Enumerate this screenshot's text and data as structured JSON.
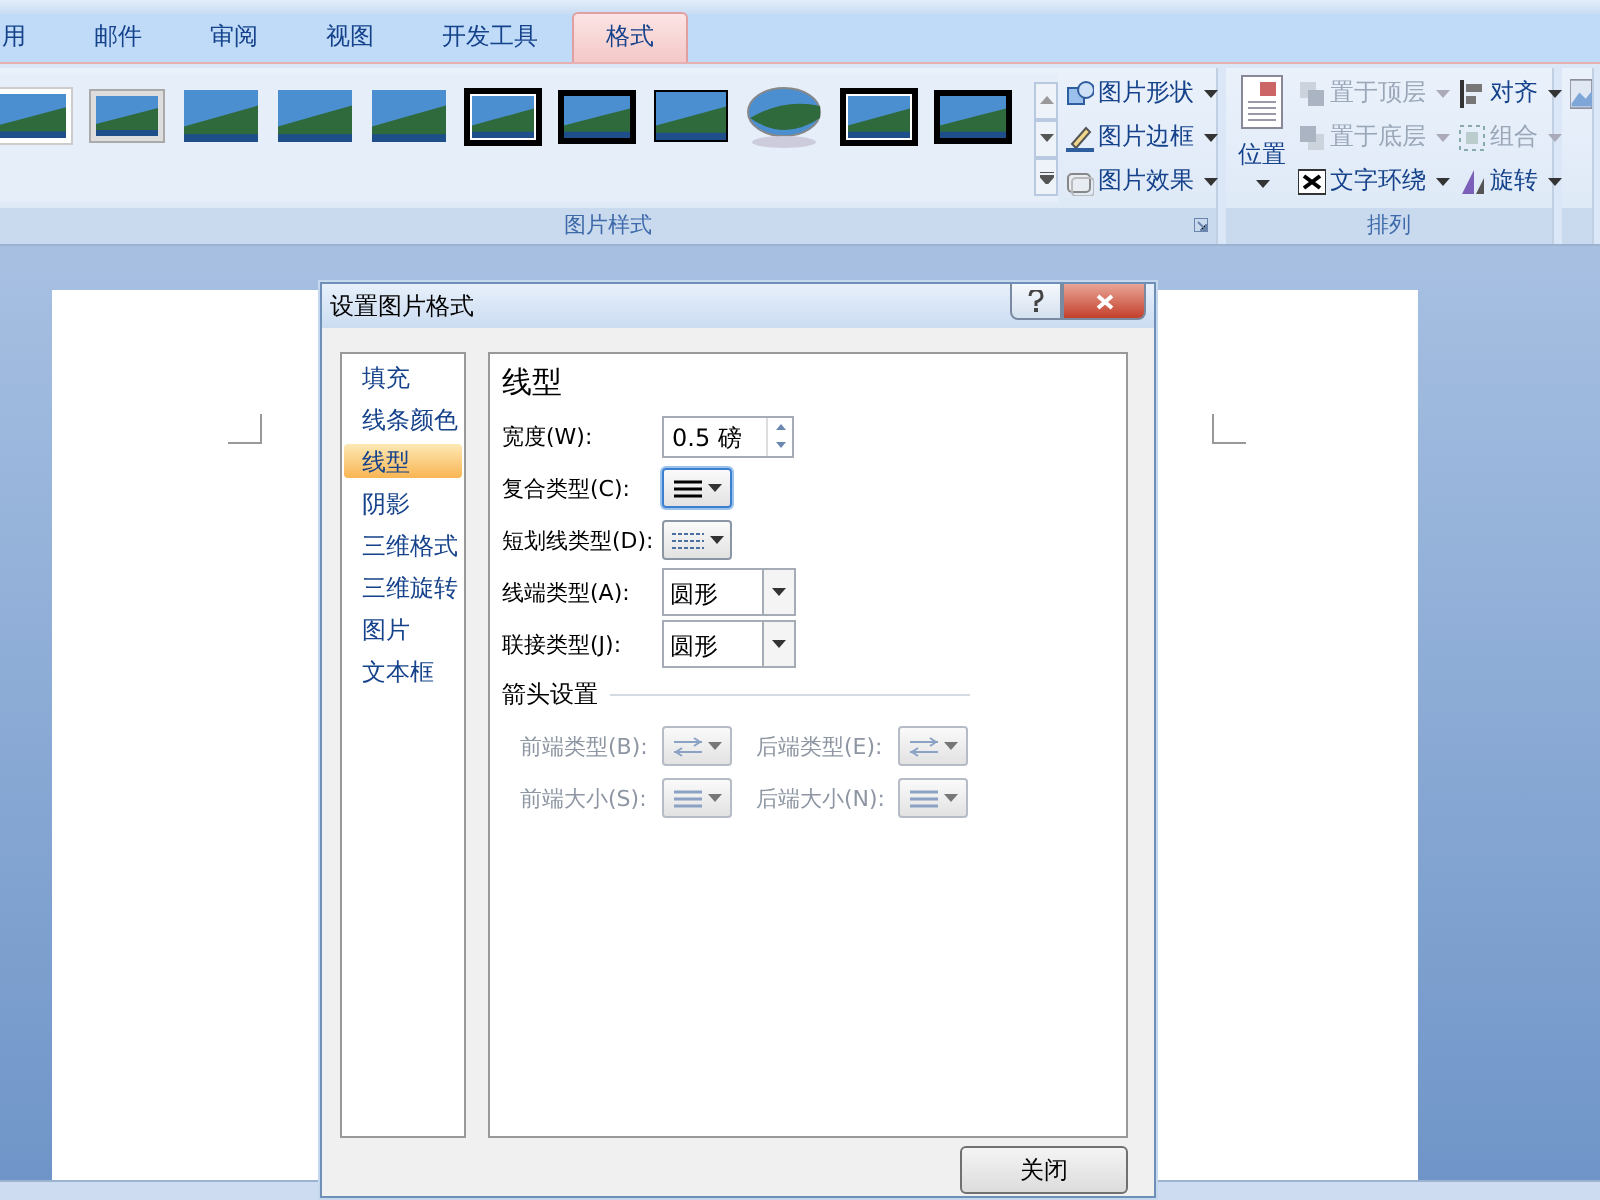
{
  "tabs": [
    {
      "label": "用",
      "selected": false
    },
    {
      "label": "邮件",
      "selected": false
    },
    {
      "label": "审阅",
      "selected": false
    },
    {
      "label": "视图",
      "selected": false
    },
    {
      "label": "开发工具",
      "selected": false
    },
    {
      "label": "格式",
      "selected": true
    }
  ],
  "picture_styles": {
    "label": "图片样式",
    "commands": [
      {
        "label": "图片形状",
        "kind": "shape"
      },
      {
        "label": "图片边框",
        "kind": "border"
      },
      {
        "label": "图片效果",
        "kind": "effect"
      }
    ]
  },
  "arrange": {
    "label": "排列",
    "position": "位置",
    "commands": [
      {
        "label": "置于顶层",
        "kind": "front",
        "disabled": true
      },
      {
        "label": "对齐",
        "kind": "align",
        "disabled": false
      },
      {
        "label": "置于底层",
        "kind": "back",
        "disabled": true
      },
      {
        "label": "组合",
        "kind": "group",
        "disabled": true
      },
      {
        "label": "文字环绕",
        "kind": "wrap",
        "disabled": false
      },
      {
        "label": "旋转",
        "kind": "rotate",
        "disabled": false
      }
    ]
  },
  "dialog": {
    "title": "设置图片格式",
    "nav": [
      {
        "label": "填充",
        "selected": false
      },
      {
        "label": "线条颜色",
        "selected": false
      },
      {
        "label": "线型",
        "selected": true
      },
      {
        "label": "阴影",
        "selected": false
      },
      {
        "label": "三维格式",
        "selected": false
      },
      {
        "label": "三维旋转",
        "selected": false
      },
      {
        "label": "图片",
        "selected": false
      },
      {
        "label": "文本框",
        "selected": false
      }
    ],
    "section_title": "线型",
    "fields": [
      {
        "kind": "spin",
        "label": "宽度(W):",
        "value": "0.5 磅"
      },
      {
        "kind": "compound",
        "label": "复合类型(C):"
      },
      {
        "kind": "dash",
        "label": "短划线类型(D):"
      },
      {
        "kind": "select",
        "label": "线端类型(A):",
        "value": "圆形"
      },
      {
        "kind": "select",
        "label": "联接类型(J):",
        "value": "圆形"
      }
    ],
    "arrow_heading": "箭头设置",
    "arrow_fields": [
      {
        "kind": "type",
        "label": "前端类型(B):",
        "disabled": true
      },
      {
        "kind": "type",
        "label": "后端类型(E):",
        "disabled": true
      },
      {
        "kind": "size",
        "label": "前端大小(S):",
        "disabled": true
      },
      {
        "kind": "size",
        "label": "后端大小(N):",
        "disabled": true
      }
    ],
    "close_button": "关闭"
  }
}
